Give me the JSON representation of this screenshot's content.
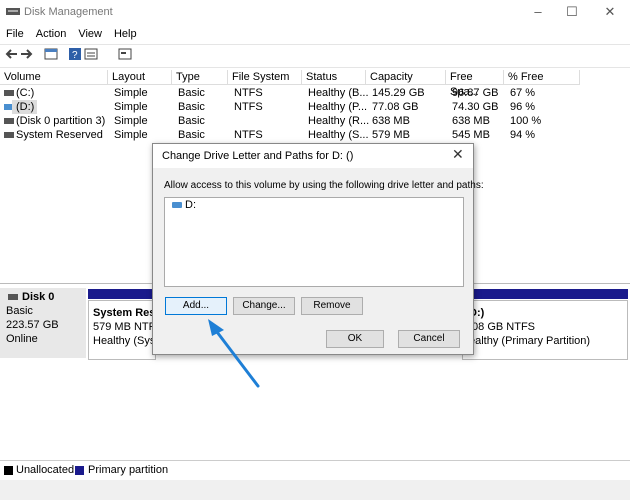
{
  "window": {
    "title": "Disk Management"
  },
  "menu": [
    "File",
    "Action",
    "View",
    "Help"
  ],
  "table": {
    "headers": [
      "Volume",
      "Layout",
      "Type",
      "File System",
      "Status",
      "Capacity",
      "Free Spa...",
      "% Free"
    ],
    "rows": [
      [
        "(C:)",
        "Simple",
        "Basic",
        "NTFS",
        "Healthy (B...",
        "145.29 GB",
        "96.87 GB",
        "67 %"
      ],
      [
        "(D:)",
        "Simple",
        "Basic",
        "NTFS",
        "Healthy (P...",
        "77.08 GB",
        "74.30 GB",
        "96 %"
      ],
      [
        "(Disk 0 partition 3)",
        "Simple",
        "Basic",
        "",
        "Healthy (R...",
        "638 MB",
        "638 MB",
        "100 %"
      ],
      [
        "System Reserved",
        "Simple",
        "Basic",
        "NTFS",
        "Healthy (S...",
        "579 MB",
        "545 MB",
        "94 %"
      ]
    ]
  },
  "disk": {
    "name": "Disk 0",
    "type": "Basic",
    "size": "223.57 GB",
    "state": "Online",
    "partitions": [
      {
        "title": "System Rese",
        "line1": "579 MB NTFS",
        "line2": "Healthy (Syste"
      },
      {
        "title": "D:)",
        "line1": ".08 GB NTFS",
        "line2": "ealthy (Primary Partition)"
      }
    ]
  },
  "legend": {
    "unallocated": "Unallocated",
    "primary": "Primary partition",
    "unallocated_color": "#000000",
    "primary_color": "#1a1a8c"
  },
  "dialog": {
    "title": "Change Drive Letter and Paths for D: ()",
    "description": "Allow access to this volume by using the following drive letter and paths:",
    "list_item": "D:",
    "buttons": {
      "add": "Add...",
      "change": "Change...",
      "remove": "Remove",
      "ok": "OK",
      "cancel": "Cancel"
    }
  },
  "annotation": {
    "arrow_color": "#1e7fd6"
  }
}
